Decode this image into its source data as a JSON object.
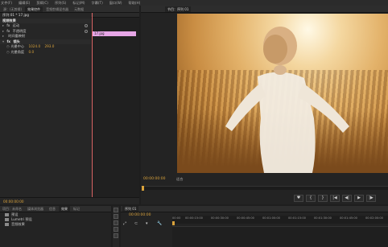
{
  "menu": [
    "文件(F)",
    "编辑(E)",
    "剪辑(C)",
    "序列(S)",
    "标记(M)",
    "字幕(T)",
    "窗口(W)",
    "帮助(H)"
  ],
  "effect_controls": {
    "tabs": [
      "源：(无剪辑)",
      "效果控件",
      "音频剪辑混合器",
      "元数据"
    ],
    "clip_label": "序列 01 * 17.jpg",
    "section_video": "视频效果",
    "rows": [
      {
        "fx": "fx",
        "name": "运动"
      },
      {
        "fx": "fx",
        "name": "不透明度"
      },
      {
        "fx": "",
        "name": "时间重映射"
      },
      {
        "fx": "fx",
        "name": "镜头"
      },
      {
        "fx": "",
        "name": "光晕中心",
        "values": [
          "1024.0",
          "293.0"
        ]
      },
      {
        "fx": "",
        "name": "光晕角度",
        "values": [
          "0.0"
        ]
      }
    ],
    "chip": "17.jpg",
    "timecode": "00:00:00:00"
  },
  "program": {
    "tabs": [
      "节目：序列 01"
    ],
    "timecode": "00:00:00:00",
    "zoom": "适合",
    "transport": [
      "♥",
      "{",
      "}",
      "|◀",
      "◀|",
      "▶",
      "|▶"
    ]
  },
  "project": {
    "tabs": [
      "项目：未命名",
      "媒体浏览器",
      "信息",
      "效果",
      "标记"
    ],
    "items": [
      "预设",
      "Lumetri 预设",
      "音频效果"
    ]
  },
  "timeline": {
    "tabs": [
      "序列 01"
    ],
    "timecode": "00:00:00:00",
    "ruler": [
      "00:00",
      "00:00:15:00",
      "00:00:30:00",
      "00:00:45:00",
      "00:01:00:00",
      "00:01:15:00",
      "00:01:30:00",
      "00:01:45:00",
      "00:02:00:00"
    ]
  }
}
